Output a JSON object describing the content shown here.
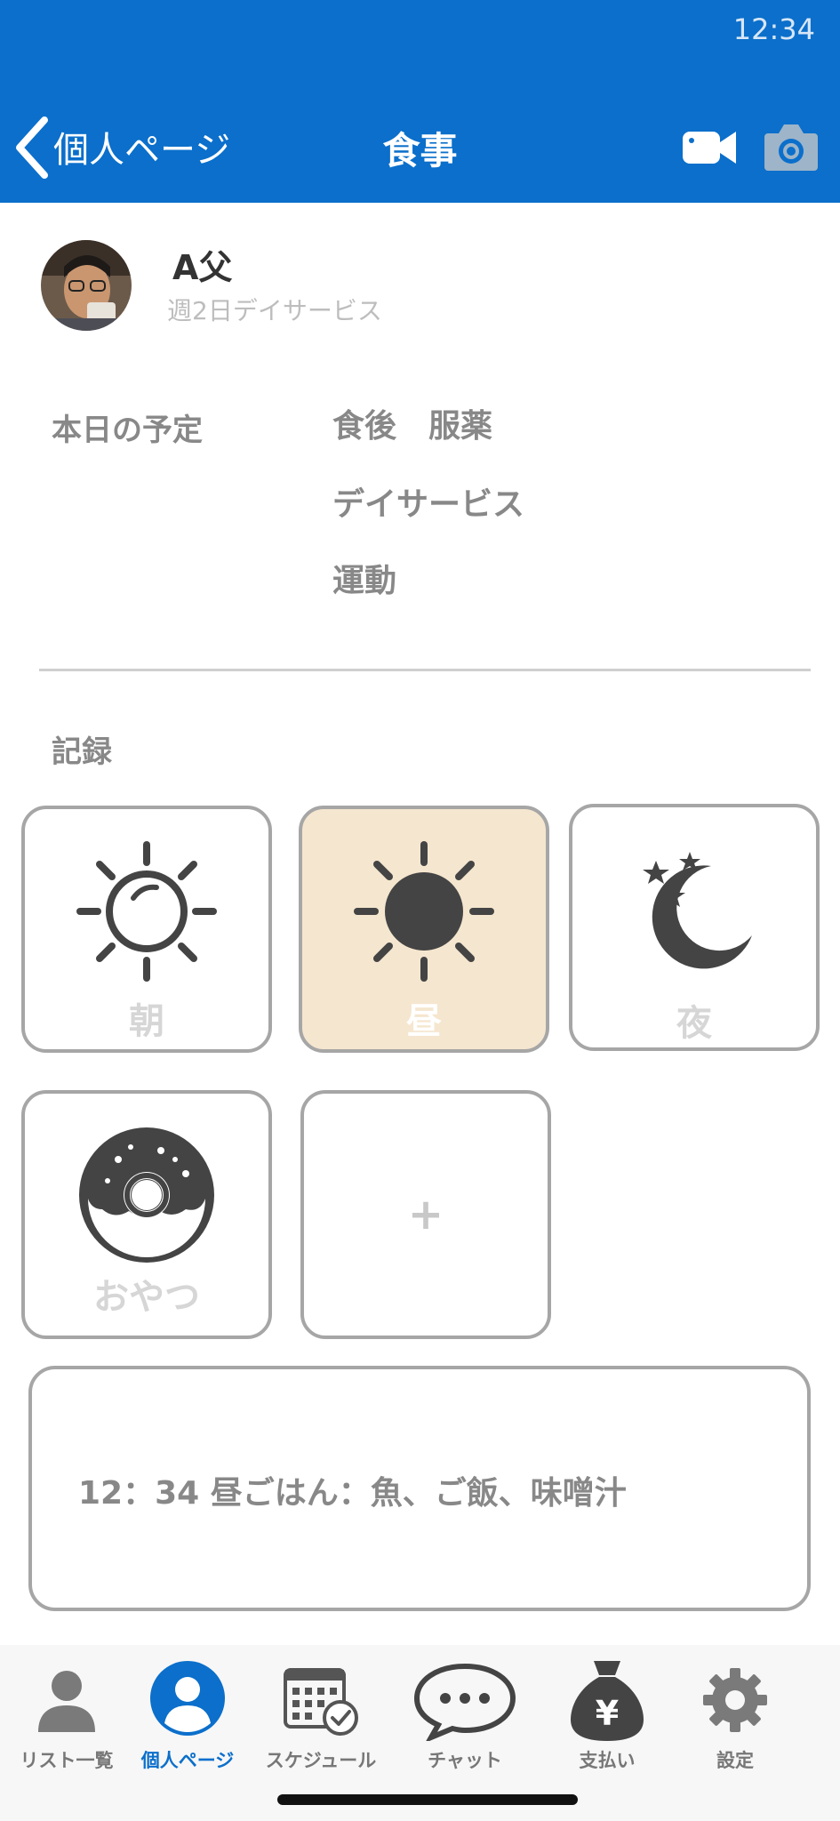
{
  "status_bar": {
    "time": "12:34"
  },
  "header": {
    "back_label": "個人ページ",
    "title": "食事",
    "bg_color": "#0b6fcb"
  },
  "profile": {
    "name": "A父",
    "subtitle": "週2日デイサービス"
  },
  "schedule": {
    "label": "本日の予定",
    "items": [
      "食後　服薬",
      "デイサービス",
      "運動"
    ]
  },
  "record": {
    "label": "記録",
    "tiles": [
      {
        "label": "朝",
        "icon": "sun-outline-icon",
        "selected": false
      },
      {
        "label": "昼",
        "icon": "sun-filled-icon",
        "selected": true
      },
      {
        "label": "夜",
        "icon": "moon-stars-icon",
        "selected": false
      },
      {
        "label": "おやつ",
        "icon": "donut-icon",
        "selected": false
      },
      {
        "label": "+",
        "icon": "plus-icon",
        "selected": false
      }
    ],
    "selected_color": "#f5e6cf"
  },
  "note": {
    "text": "12：34 昼ごはん：魚、ご飯、味噌汁"
  },
  "tabbar": {
    "items": [
      {
        "label": "リスト一覧",
        "icon": "person-icon",
        "active": false
      },
      {
        "label": "個人ページ",
        "icon": "person-circle-icon",
        "active": true
      },
      {
        "label": "スケジュール",
        "icon": "calendar-check-icon",
        "active": false
      },
      {
        "label": "チャット",
        "icon": "chat-bubble-icon",
        "active": false
      },
      {
        "label": "支払い",
        "icon": "money-bag-yen-icon",
        "active": false
      },
      {
        "label": "設定",
        "icon": "gear-icon",
        "active": false
      }
    ],
    "active_color": "#0b6fcb"
  }
}
